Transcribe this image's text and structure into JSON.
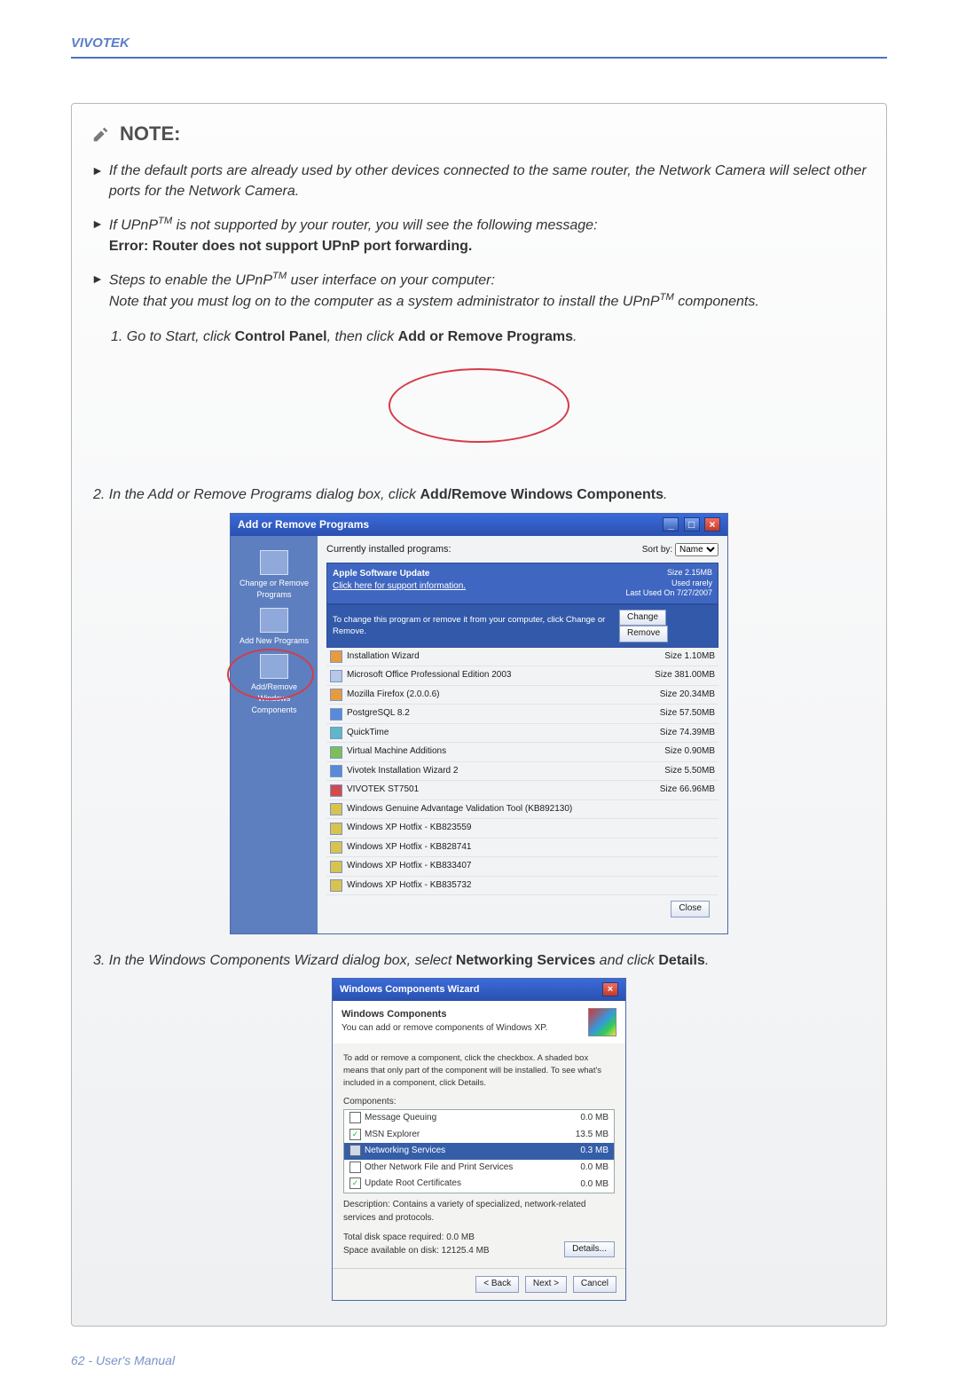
{
  "brand": "VIVOTEK",
  "footer": "62 - User's Manual",
  "note_title": "NOTE:",
  "note_items": [
    {
      "text_a": "If the default ports are already used by other devices connected to the same router, the Network Camera will select other ports for the Network Camera."
    },
    {
      "text_a": "If UPnP",
      "sup": "TM",
      "text_b": " is not supported by your router, you will see the following message:",
      "bold_line": "Error: Router does not support UPnP port forwarding."
    },
    {
      "text_a": "Steps to enable the UPnP",
      "sup": "TM",
      "text_b": " user interface on your computer:",
      "text_c": "Note that you must log on to the computer as a system administrator to install the UPnP",
      "sup2": "TM",
      "text_d": " components."
    }
  ],
  "step1": {
    "num": "1.",
    "a": "Go to Start, click ",
    "b1": "Control Panel",
    "b": ", then click ",
    "b2": "Add or Remove Programs",
    "c": "."
  },
  "step2": {
    "num": "2.",
    "a": "In the Add or Remove Programs dialog box, click ",
    "b": "Add/Remove Windows Components",
    "c": "."
  },
  "arp": {
    "title": "Add or Remove Programs",
    "current_label": "Currently installed programs:",
    "sort_label": "Sort by:",
    "sort_value": "Name",
    "side": {
      "change": "Change or Remove Programs",
      "addnew": "Add New Programs",
      "addwin": "Add/Remove Windows Components"
    },
    "sel_app": {
      "name": "Apple Software Update",
      "support": "Click here for support information.",
      "size_label": "Size",
      "size": "2.15MB",
      "used_label": "Used",
      "used": "rarely",
      "last_used_label": "Last Used On",
      "last_used": "7/27/2007",
      "hint": "To change this program or remove it from your computer, click Change or Remove.",
      "change_btn": "Change",
      "remove_btn": "Remove"
    },
    "rows": [
      {
        "name": "Installation Wizard",
        "right": "Size   1.10MB"
      },
      {
        "name": "Microsoft Office Professional Edition 2003",
        "right": "Size   381.00MB"
      },
      {
        "name": "Mozilla Firefox (2.0.0.6)",
        "right": "Size   20.34MB"
      },
      {
        "name": "PostgreSQL 8.2",
        "right": "Size   57.50MB"
      },
      {
        "name": "QuickTime",
        "right": "Size   74.39MB"
      },
      {
        "name": "Virtual Machine Additions",
        "right": "Size   0.90MB"
      },
      {
        "name": "Vivotek Installation Wizard 2",
        "right": "Size   5.50MB"
      },
      {
        "name": "VIVOTEK ST7501",
        "right": "Size   66.96MB"
      },
      {
        "name": "Windows Genuine Advantage Validation Tool (KB892130)",
        "right": ""
      },
      {
        "name": "Windows XP Hotfix - KB823559",
        "right": ""
      },
      {
        "name": "Windows XP Hotfix - KB828741",
        "right": ""
      },
      {
        "name": "Windows XP Hotfix - KB833407",
        "right": ""
      },
      {
        "name": "Windows XP Hotfix - KB835732",
        "right": ""
      }
    ],
    "close": "Close"
  },
  "step3": {
    "num": "3.",
    "a": "In the Windows Components Wizard dialog box, select ",
    "b": "Networking Services",
    "c": " and click ",
    "d": "Details",
    "e": "."
  },
  "wiz": {
    "title": "Windows Components Wizard",
    "h1": "Windows Components",
    "h2": "You can add or remove components of Windows XP.",
    "desc": "To add or remove a component, click the checkbox. A shaded box means that only part of the component will be installed. To see what's included in a component, click Details.",
    "comp_label": "Components:",
    "components": [
      {
        "name": "Message Queuing",
        "size": "0.0 MB"
      },
      {
        "name": "MSN Explorer",
        "size": "13.5 MB"
      },
      {
        "name": "Networking Services",
        "size": "0.3 MB"
      },
      {
        "name": "Other Network File and Print Services",
        "size": "0.0 MB"
      },
      {
        "name": "Update Root Certificates",
        "size": "0.0 MB"
      }
    ],
    "desc2_label": "Description:",
    "desc2": "Contains a variety of specialized, network-related services and protocols.",
    "req_label": "Total disk space required:",
    "req": "0.0 MB",
    "avail_label": "Space available on disk:",
    "avail": "12125.4 MB",
    "details_btn": "Details...",
    "back": "< Back",
    "next": "Next >",
    "cancel": "Cancel"
  }
}
